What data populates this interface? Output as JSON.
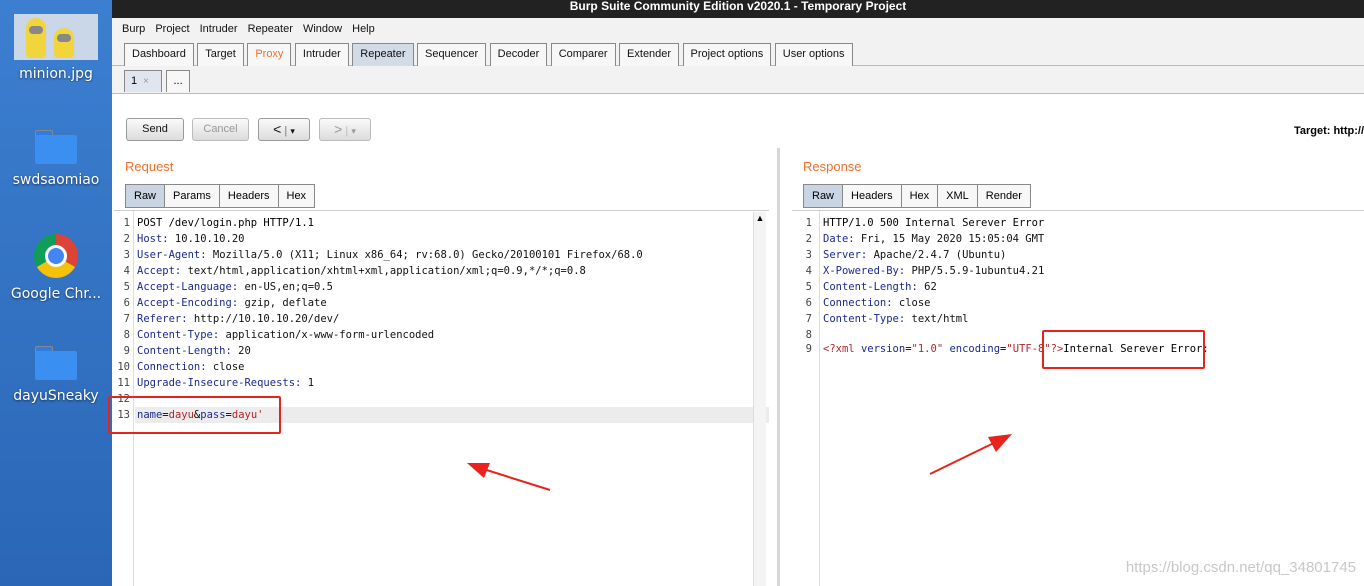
{
  "desktop": {
    "icons": [
      {
        "label": "minion.jpg",
        "icon": "image-file-icon"
      },
      {
        "label": "swdsaomiao",
        "icon": "folder-icon"
      },
      {
        "label": "Google Chr...",
        "icon": "chrome-icon"
      },
      {
        "label": "dayuSneaky",
        "icon": "folder-icon"
      }
    ]
  },
  "window": {
    "title": "Burp Suite Community Edition v2020.1 - Temporary Project",
    "menu": [
      "Burp",
      "Project",
      "Intruder",
      "Repeater",
      "Window",
      "Help"
    ],
    "tabs": [
      "Dashboard",
      "Target",
      "Proxy",
      "Intruder",
      "Repeater",
      "Sequencer",
      "Decoder",
      "Comparer",
      "Extender",
      "Project options",
      "User options"
    ],
    "active_tab": "Repeater",
    "subtabs": {
      "first": "1",
      "close": "×",
      "more": "..."
    }
  },
  "toolbar": {
    "send": "Send",
    "cancel": "Cancel",
    "back": "<",
    "forward": ">",
    "dropdown": "▾",
    "target": "Target: http://"
  },
  "request": {
    "heading": "Request",
    "tabs": [
      "Raw",
      "Params",
      "Headers",
      "Hex"
    ],
    "lines": [
      {
        "n": "1",
        "text": "POST /dev/login.php HTTP/1.1"
      },
      {
        "n": "2",
        "key": "Host",
        "val": " 10.10.10.20"
      },
      {
        "n": "3",
        "key": "User-Agent",
        "val": " Mozilla/5.0 (X11; Linux x86_64; rv:68.0) Gecko/20100101 Firefox/68.0"
      },
      {
        "n": "4",
        "key": "Accept",
        "val": " text/html,application/xhtml+xml,application/xml;q=0.9,*/*;q=0.8"
      },
      {
        "n": "5",
        "key": "Accept-Language",
        "val": " en-US,en;q=0.5"
      },
      {
        "n": "6",
        "key": "Accept-Encoding",
        "val": " gzip, deflate"
      },
      {
        "n": "7",
        "key": "Referer",
        "val": " http://10.10.10.20/dev/"
      },
      {
        "n": "8",
        "key": "Content-Type",
        "val": " application/x-www-form-urlencoded"
      },
      {
        "n": "9",
        "key": "Content-Length",
        "val": " 20"
      },
      {
        "n": "10",
        "key": "Connection",
        "val": " close"
      },
      {
        "n": "11",
        "key": "Upgrade-Insecure-Requests",
        "val": " 1"
      },
      {
        "n": "12",
        "text": ""
      }
    ],
    "body": {
      "n": "13",
      "k1": "name",
      "v1": "dayu",
      "k2": "pass",
      "v2": "dayu'"
    }
  },
  "response": {
    "heading": "Response",
    "tabs": [
      "Raw",
      "Headers",
      "Hex",
      "XML",
      "Render"
    ],
    "lines": [
      {
        "n": "1",
        "text": "HTTP/1.0 500 Internal Serever Error"
      },
      {
        "n": "2",
        "key": "Date",
        "val": " Fri, 15 May 2020 15:05:04 GMT"
      },
      {
        "n": "3",
        "key": "Server",
        "val": " Apache/2.4.7 (Ubuntu)"
      },
      {
        "n": "4",
        "key": "X-Powered-By",
        "val": " PHP/5.5.9-1ubuntu4.21"
      },
      {
        "n": "5",
        "key": "Content-Length",
        "val": " 62"
      },
      {
        "n": "6",
        "key": "Connection",
        "val": " close"
      },
      {
        "n": "7",
        "key": "Content-Type",
        "val": " text/html"
      },
      {
        "n": "8",
        "text": ""
      }
    ],
    "xml": {
      "n": "9",
      "open": "<?xml",
      "a1": "version",
      "v1": "\"1.0\"",
      "a2": "encoding",
      "v2": "\"UTF-8\"",
      "close": "?>",
      "text": "Internal Serever Error:"
    }
  },
  "watermark": "https://blog.csdn.net/qq_34801745"
}
